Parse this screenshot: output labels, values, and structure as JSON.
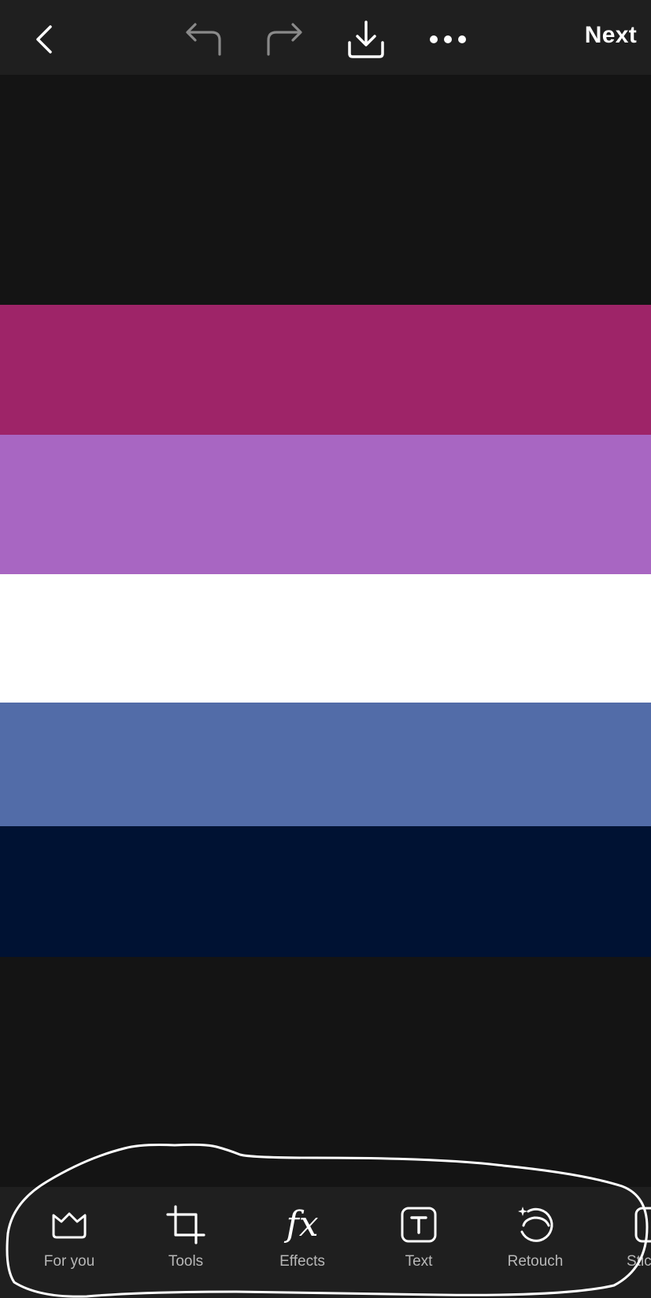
{
  "header": {
    "next_label": "Next"
  },
  "flag_stripes": [
    {
      "color": "#141414"
    },
    {
      "color": "#9e2468"
    },
    {
      "color": "#a866c2"
    },
    {
      "color": "#ffffff"
    },
    {
      "color": "#526ca8"
    },
    {
      "color": "#001233"
    },
    {
      "color": "#141414"
    }
  ],
  "toolbar": {
    "items": [
      {
        "label": "For you",
        "icon": "crown-icon"
      },
      {
        "label": "Tools",
        "icon": "crop-icon"
      },
      {
        "label": "Effects",
        "icon": "fx-icon"
      },
      {
        "label": "Text",
        "icon": "text-box-icon"
      },
      {
        "label": "Retouch",
        "icon": "retouch-face-icon"
      },
      {
        "label": "Stic",
        "icon": "sticker-icon"
      }
    ]
  },
  "colors": {
    "bar_bg": "#1f1f1f",
    "canvas_bg": "#141414",
    "label_color": "#b8b8b8"
  }
}
